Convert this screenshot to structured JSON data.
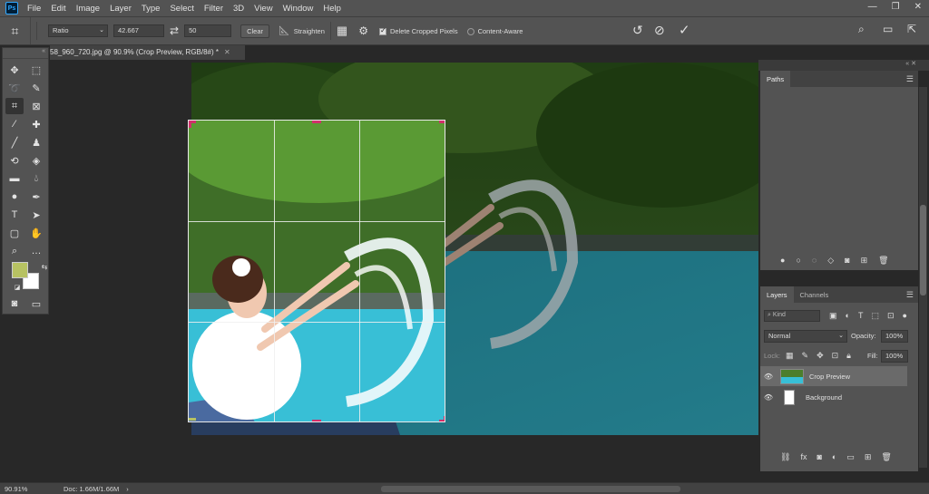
{
  "menubar": {
    "logo": "Ps",
    "items": [
      "File",
      "Edit",
      "Image",
      "Layer",
      "Type",
      "Select",
      "Filter",
      "3D",
      "View",
      "Window",
      "Help"
    ],
    "window_controls": [
      "—",
      "❐",
      "✕"
    ]
  },
  "options": {
    "ratio_label": "Ratio",
    "width_value": "42.667",
    "height_value": "50",
    "clear_label": "Clear",
    "straighten_label": "Straighten",
    "delete_cropped_label": "Delete Cropped Pixels",
    "content_aware_label": "Content-Aware"
  },
  "document": {
    "tab_title": "58_960_720.jpg @ 90.9% (Crop Preview, RGB/8#) *"
  },
  "status": {
    "zoom": "90.91%",
    "doc_size": "Doc: 1.66M/1.66M"
  },
  "panels": {
    "paths_tab": "Paths",
    "layers_tab": "Layers",
    "channels_tab": "Channels",
    "kind_placeholder": "Kind",
    "blend_mode": "Normal",
    "opacity_label": "Opacity:",
    "opacity_value": "100%",
    "lock_label": "Lock:",
    "fill_label": "Fill:",
    "fill_value": "100%",
    "layers": [
      {
        "name": "Crop Preview",
        "selected": true
      },
      {
        "name": "Background",
        "selected": false
      }
    ]
  },
  "colors": {
    "foreground": "#b7c262",
    "background": "#ffffff",
    "crop_handle": "#d0306a"
  }
}
